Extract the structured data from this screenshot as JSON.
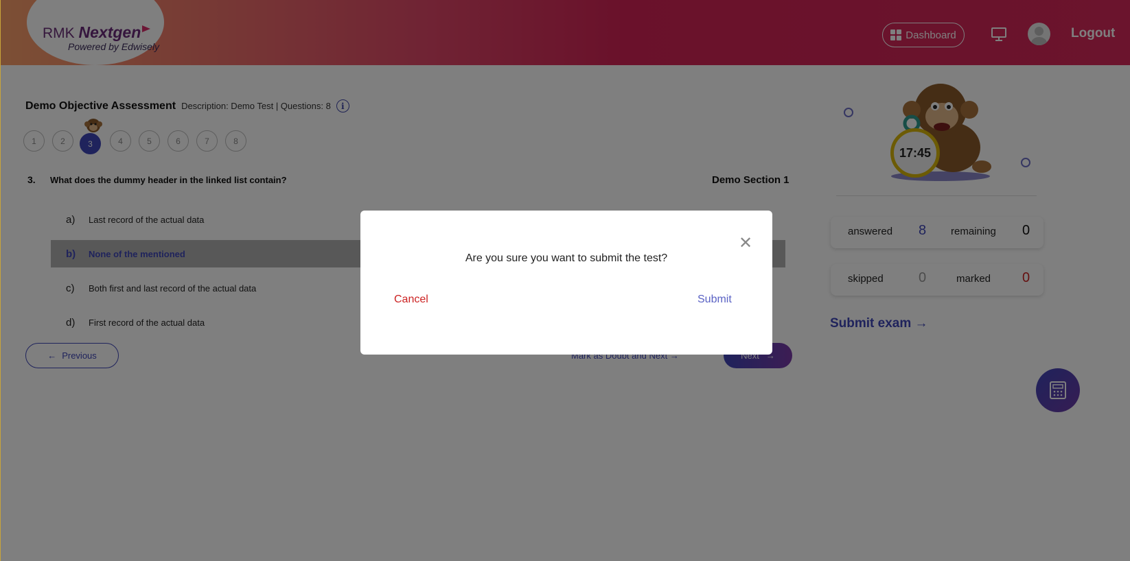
{
  "header": {
    "logo_prefix": "RMK",
    "logo_brand": "Nextgen",
    "logo_tagline": "Powered by Edwisely",
    "dashboard_label": "Dashboard",
    "logout_label": "Logout"
  },
  "assessment": {
    "title": "Demo Objective Assessment",
    "description": "Description: Demo Test | Questions: 8"
  },
  "question_nav": [
    "1",
    "2",
    "3",
    "4",
    "5",
    "6",
    "7",
    "8"
  ],
  "question": {
    "number": "3.",
    "text": "What does the dummy header in the linked list contain?",
    "section": "Demo Section 1",
    "options": [
      {
        "letter": "a)",
        "text": "Last record of the actual data"
      },
      {
        "letter": "b)",
        "text": "None of the mentioned"
      },
      {
        "letter": "c)",
        "text": "Both first and last record of the actual data"
      },
      {
        "letter": "d)",
        "text": "First record of the actual data"
      }
    ]
  },
  "actions": {
    "previous_label": "Previous",
    "doubt_label": "Mark as Doubt and Next",
    "next_label": "Next"
  },
  "sidebar": {
    "timer": "17:45",
    "answered_label": "answered",
    "answered_value": "8",
    "remaining_label": "remaining",
    "remaining_value": "0",
    "skipped_label": "skipped",
    "skipped_value": "0",
    "marked_label": "marked",
    "marked_value": "0",
    "submit_exam_label": "Submit exam"
  },
  "modal": {
    "message": "Are you sure you want to submit the test?",
    "cancel_label": "Cancel",
    "submit_label": "Submit"
  },
  "colors": {
    "accent": "#3f46b8",
    "header_pink": "#d42356",
    "cancel_red": "#cc2222",
    "timer_ring": "#d8b70a"
  }
}
